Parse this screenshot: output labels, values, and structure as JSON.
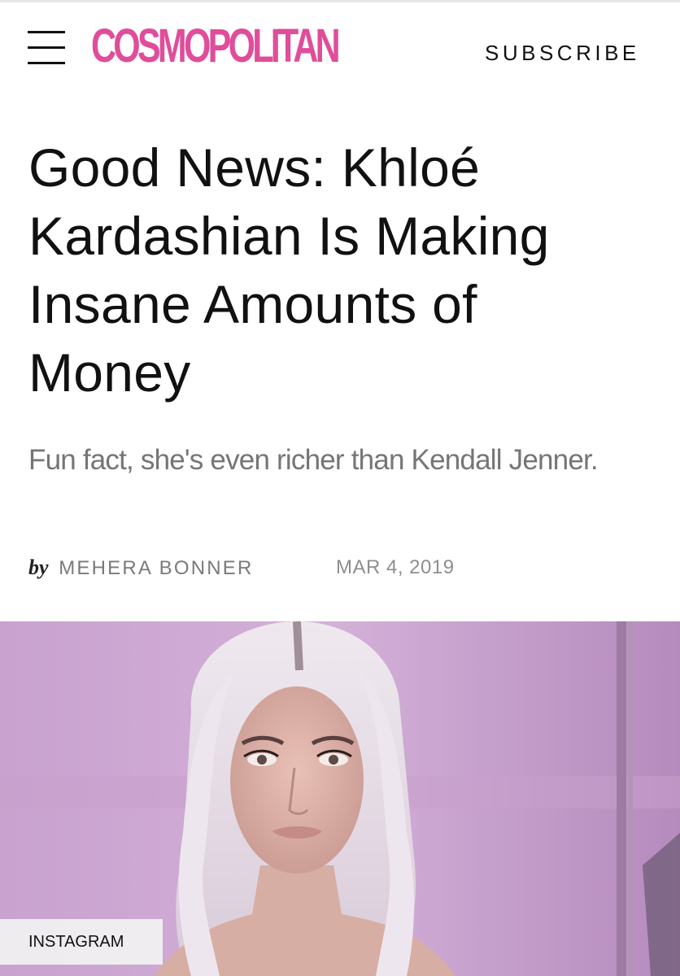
{
  "header": {
    "logo_text": "COSMOPOLITAN",
    "subscribe_label": "SUBSCRIBE",
    "brand_color": "#e04d9a",
    "menu_icon": "hamburger-menu-icon"
  },
  "article": {
    "headline": "Good News: Khloé Kardashian Is Making Insane Amounts of Money",
    "dek": "Fun fact, she's even richer than Kendall Jenner.",
    "byline_prefix": "by",
    "author": "MEHERA BONNER",
    "date": "MAR 4, 2019"
  },
  "hero": {
    "photo_credit": "INSTAGRAM"
  }
}
